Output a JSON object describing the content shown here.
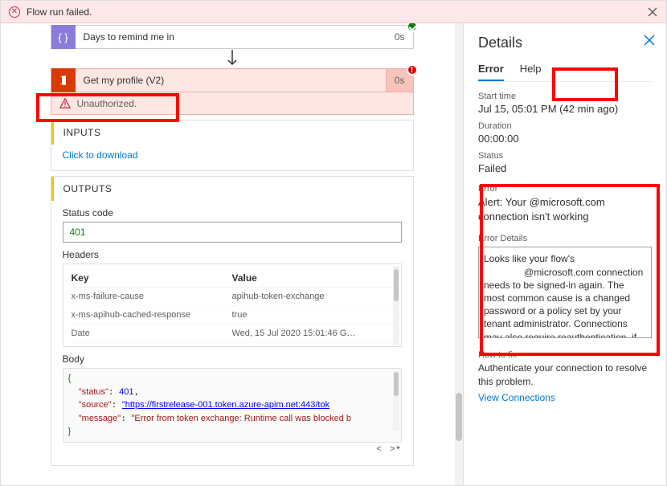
{
  "banner": {
    "message": "Flow run failed."
  },
  "steps": {
    "step1": {
      "icon": "{ }",
      "title": "Days to remind me in",
      "timing": "0s"
    },
    "step2": {
      "icon": "O",
      "title": "Get my profile (V2)",
      "timing": "0s",
      "unauth_icon": "!",
      "unauth_text": "Unauthorized."
    }
  },
  "inputs": {
    "heading": "INPUTS",
    "download": "Click to download"
  },
  "outputs": {
    "heading": "OUTPUTS",
    "status_label": "Status code",
    "status_value": "401",
    "headers_label": "Headers",
    "th_key": "Key",
    "th_val": "Value",
    "rows": [
      {
        "k": "x-ms-failure-cause",
        "v": "apihub-token-exchange"
      },
      {
        "k": "x-ms-apihub-cached-response",
        "v": "true"
      },
      {
        "k": "Date",
        "v": "Wed, 15 Jul 2020 15:01:46 G…"
      }
    ],
    "body_label": "Body",
    "body": {
      "open": "{",
      "status_k": "\"status\"",
      "status_v": "401",
      "source_k": "\"source\"",
      "source_v": "\"https://firstrelease-001.token.azure-apim.net:443/tok",
      "message_k": "\"message\"",
      "message_v": "\"Error from token exchange: Runtime call was blocked b",
      "close": "}"
    }
  },
  "details": {
    "title": "Details",
    "tab_error": "Error",
    "tab_help": "Help",
    "start_label": "Start time",
    "start_value": "Jul 15, 05:01 PM (42 min ago)",
    "dur_label": "Duration",
    "dur_value": "00:00:00",
    "status_label": "Status",
    "status_value": "Failed",
    "error_label": "Error",
    "error_value": "Alert: Your            @microsoft.com connection isn't working",
    "ed_label": "Error Details",
    "ed_value": "Looks like your flow's\n               @microsoft.com connection needs to be signed-in again. The most common cause is a changed password or a policy set by your tenant administrator. Connections may also require reauthentication, if multi-factor authentication has been recently",
    "fix_label": "How to fix",
    "fix_value": "Authenticate your connection to resolve this problem.",
    "fix_link": "View Connections"
  }
}
